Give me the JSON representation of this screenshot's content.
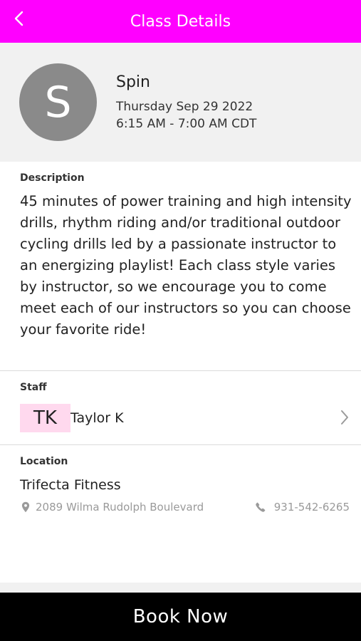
{
  "header": {
    "title": "Class Details",
    "back_icon": "chevron-left-icon",
    "color": "#ff00ff"
  },
  "class_info": {
    "avatar_initial": "S",
    "name": "Spin",
    "date": "Thursday Sep 29 2022",
    "time": "6:15 AM - 7:00 AM CDT"
  },
  "description": {
    "label": "Description",
    "text": "45 minutes of power training and high intensity drills, rhythm riding and/or traditional outdoor cycling drills led by a passionate instructor to an energizing playlist! Each class style varies by instructor, so we encourage you to come meet each of our instructors so you can choose your favorite ride!"
  },
  "staff": {
    "label": "Staff",
    "initials": "TK",
    "name": "Taylor K",
    "chevron_icon": "chevron-right-icon",
    "initials_bg": "#ffd9ee"
  },
  "location": {
    "label": "Location",
    "name": "Trifecta Fitness",
    "address": "2089 Wilma Rudolph Boulevard",
    "address_icon": "map-pin-icon",
    "phone": "931-542-6265",
    "phone_icon": "phone-icon"
  },
  "actions": {
    "book_label": "Book Now"
  }
}
